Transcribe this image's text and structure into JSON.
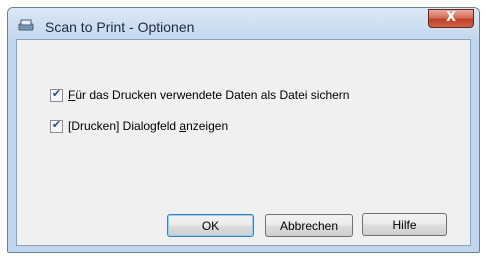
{
  "window": {
    "title": "Scan to Print - Optionen",
    "close_symbol": "X"
  },
  "options": [
    {
      "checked": true,
      "label_pre": "",
      "label_ul": "F",
      "label_post": "ür das Drucken verwendete Daten als Datei sichern"
    },
    {
      "checked": true,
      "label_pre": "[Drucken] Dialogfeld ",
      "label_ul": "a",
      "label_post": "nzeigen"
    }
  ],
  "buttons": {
    "ok": "OK",
    "cancel": "Abbrechen",
    "help": "Hilfe"
  },
  "icons": {
    "app": "scanner-icon",
    "close": "close-icon",
    "check": "checkmark-icon"
  },
  "colors": {
    "frame": "#bfd6ee",
    "close_button": "#c7503a",
    "client": "#f0f0f0"
  }
}
